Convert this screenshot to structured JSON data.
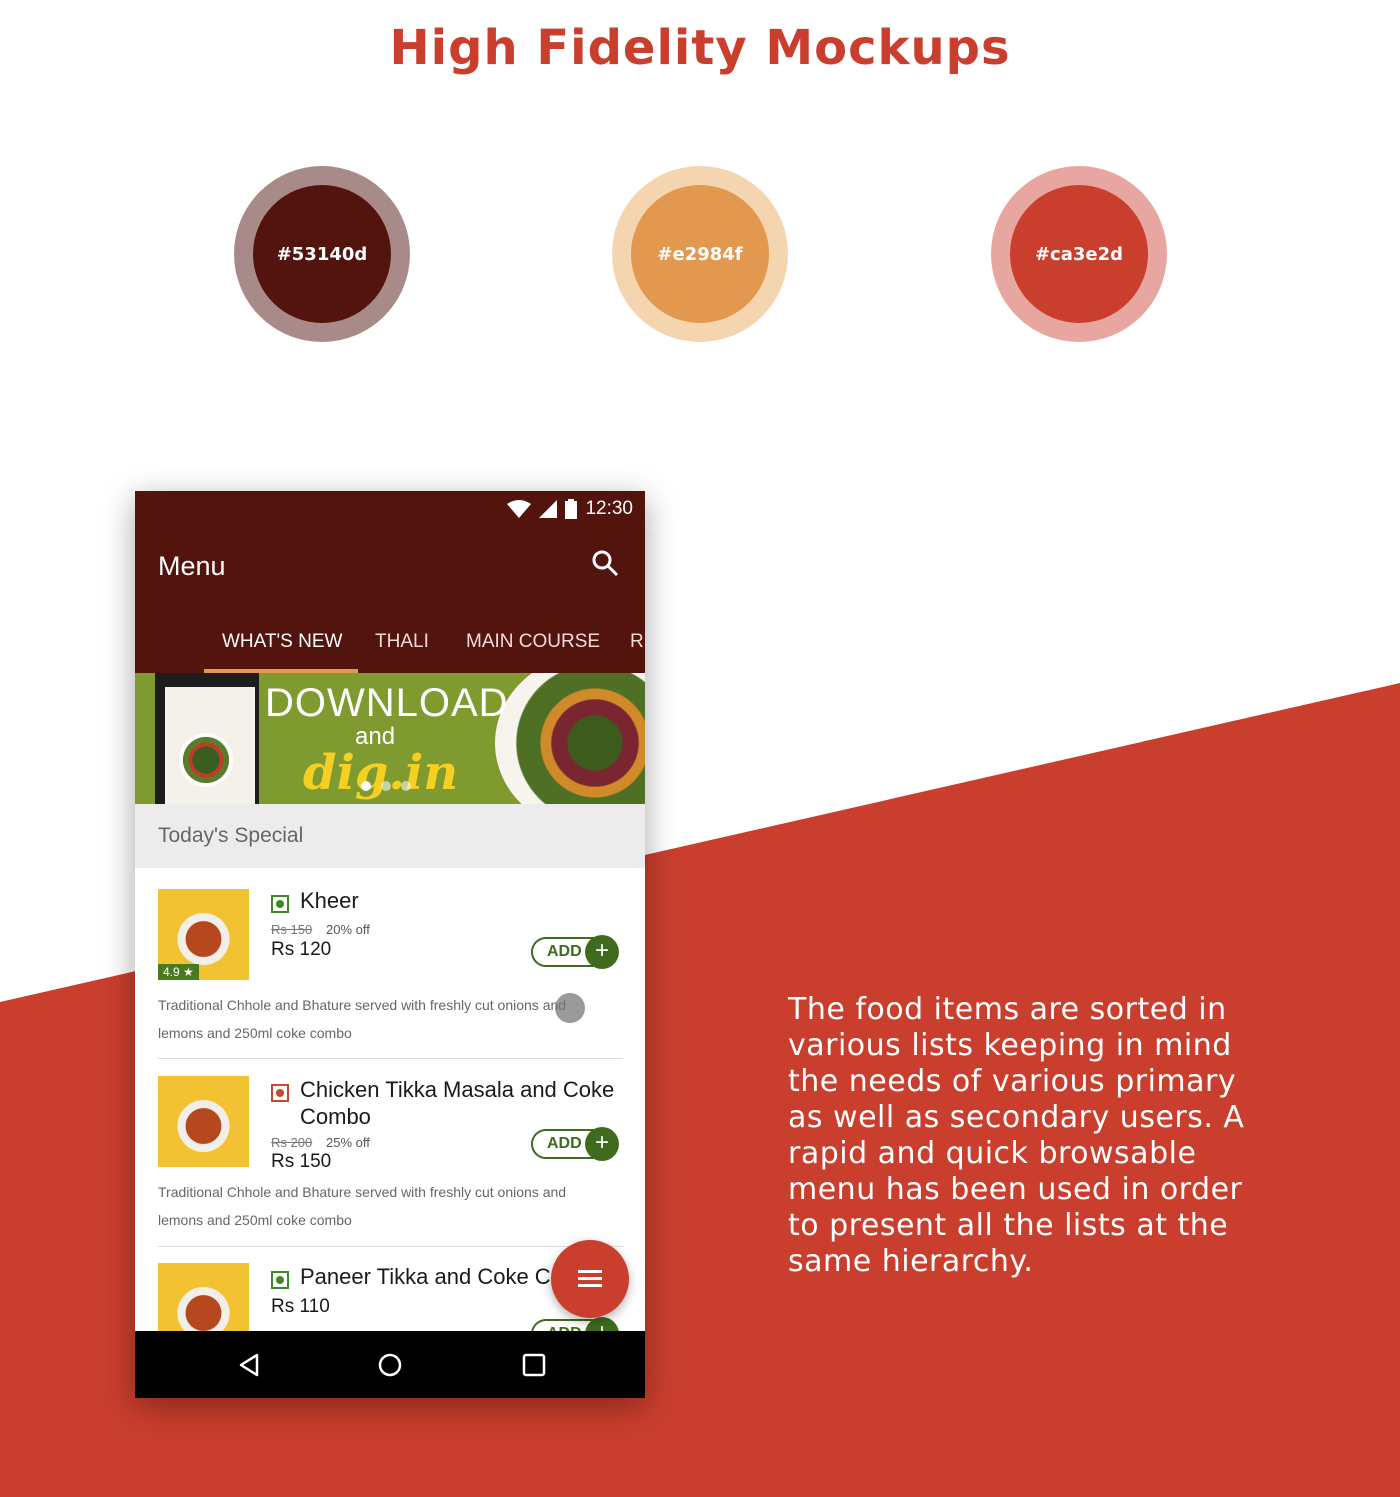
{
  "heading": "High Fidelity Mockups",
  "palette": [
    {
      "label": "#53140d",
      "color": "#53140d",
      "ring": "#a88b88"
    },
    {
      "label": "#e2984f",
      "color": "#e2984f",
      "ring": "#f5d5b0"
    },
    {
      "label": "#ca3e2d",
      "color": "#ca3e2d",
      "ring": "#e7a69f"
    }
  ],
  "description": "The food items are sorted in various lists keeping in mind the needs of various primary as well as secondary users. A rapid and quick browsable menu has been used in order to present all the lists at the same hierarchy.",
  "phone": {
    "status_time": "12:30",
    "app_title": "Menu",
    "search_icon": "search-icon",
    "tabs": [
      "WHAT'S NEW",
      "THALI",
      "MAIN COURSE",
      "RI"
    ],
    "active_tab": "WHAT'S NEW",
    "banner": {
      "line1": "DOWNLOAD",
      "line2": "and",
      "line3": "dig.in",
      "slide_count": 3,
      "active_slide": 1
    },
    "section_title": "Today's Special",
    "items": [
      {
        "name": "Kheer",
        "type": "veg",
        "rating": "4.9 ★",
        "old_price": "Rs 150",
        "discount": "20% off",
        "price": "Rs 120",
        "add_label": "ADD",
        "description": "Traditional Chhole and Bhature served with freshly cut onions and lemons and 250ml coke combo"
      },
      {
        "name": "Chicken Tikka Masala and Coke Combo",
        "type": "non-veg",
        "old_price": "Rs 200",
        "discount": "25% off",
        "price": "Rs 150",
        "add_label": "ADD",
        "description": "Traditional Chhole and Bhature served with freshly cut onions and lemons and 250ml coke combo"
      },
      {
        "name": "Paneer Tikka and Coke C",
        "type": "veg",
        "price": "Rs 110",
        "add_label": "ADD"
      }
    ],
    "fab_icon": "menu-icon",
    "nav": [
      "back-icon",
      "home-icon",
      "recents-icon"
    ]
  },
  "colors": {
    "brand_dark": "#53140d",
    "accent": "#e2984f",
    "primary_red": "#ca3e2d",
    "veg": "#3e8a2a",
    "add_green": "#3e6b1d"
  }
}
